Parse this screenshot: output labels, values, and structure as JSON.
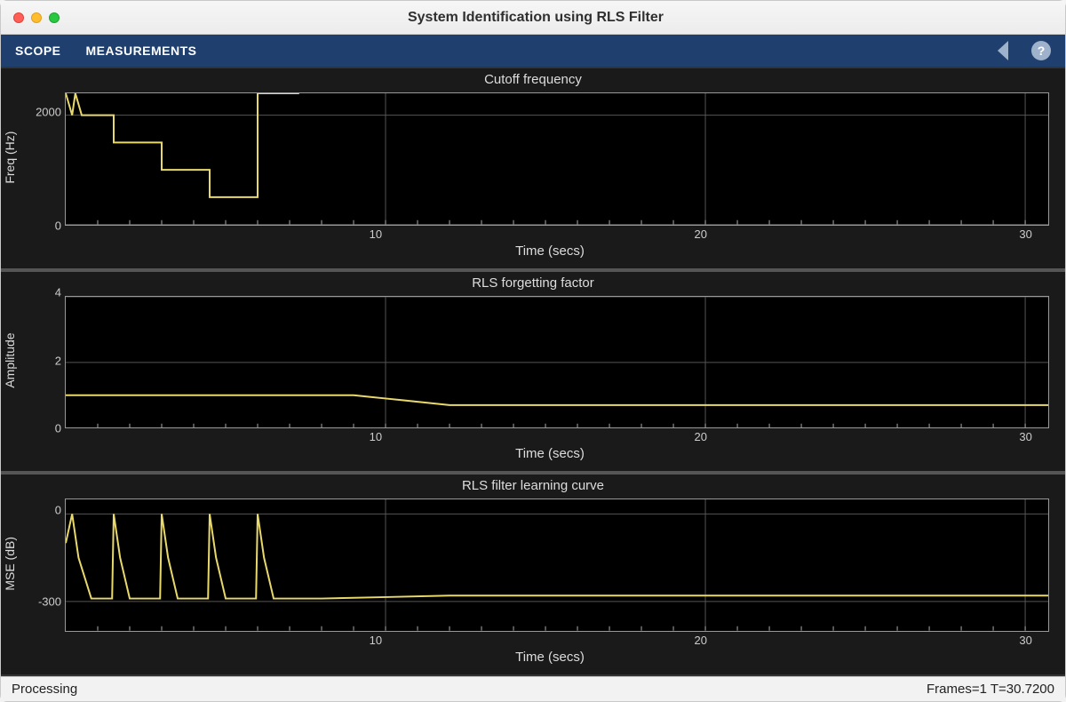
{
  "window": {
    "title": "System Identification using RLS Filter"
  },
  "toolbar": {
    "tabs": [
      "SCOPE",
      "MEASUREMENTS"
    ],
    "help_tooltip": "?"
  },
  "status": {
    "left": "Processing",
    "right": "Frames=1  T=30.7200"
  },
  "chart_data": [
    {
      "type": "line",
      "title": "Cutoff frequency",
      "xlabel": "Time (secs)",
      "ylabel": "Freq (Hz)",
      "xlim": [
        0,
        30.72
      ],
      "ylim": [
        0,
        2400
      ],
      "xticks": [
        10,
        20,
        30
      ],
      "yticks": [
        0,
        2000
      ],
      "x": [
        0,
        0.2,
        0.3,
        0.5,
        1.5,
        1.5,
        3.0,
        3.0,
        4.5,
        4.5,
        6.0,
        6.0,
        7.3,
        7.3
      ],
      "y": [
        2400,
        2000,
        2400,
        2000,
        2000,
        1500,
        1500,
        1000,
        1000,
        500,
        500,
        2400,
        2400,
        2400
      ]
    },
    {
      "type": "line",
      "title": "RLS forgetting factor",
      "xlabel": "Time (secs)",
      "ylabel": "Amplitude",
      "xlim": [
        0,
        30.72
      ],
      "ylim": [
        0,
        4
      ],
      "xticks": [
        10,
        20,
        30
      ],
      "yticks": [
        0,
        2,
        4
      ],
      "x": [
        0,
        9,
        9.5,
        10,
        10.5,
        11,
        11.5,
        12,
        30.72
      ],
      "y": [
        1,
        1,
        0.95,
        0.9,
        0.85,
        0.8,
        0.75,
        0.7,
        0.7
      ]
    },
    {
      "type": "line",
      "title": "RLS filter learning curve",
      "xlabel": "Time (secs)",
      "ylabel": "MSE (dB)",
      "xlim": [
        0,
        30.72
      ],
      "ylim": [
        -400,
        50
      ],
      "xticks": [
        10,
        20,
        30
      ],
      "yticks": [
        -300,
        0
      ],
      "x": [
        0,
        0.2,
        0.4,
        0.8,
        1.45,
        1.5,
        1.7,
        2.0,
        2.95,
        3.0,
        3.2,
        3.5,
        4.45,
        4.5,
        4.7,
        5.0,
        5.95,
        6.0,
        6.2,
        6.5,
        8,
        10,
        12,
        30.72
      ],
      "y": [
        -100,
        0,
        -150,
        -290,
        -290,
        0,
        -150,
        -290,
        -290,
        0,
        -150,
        -290,
        -290,
        0,
        -150,
        -290,
        -290,
        0,
        -150,
        -290,
        -290,
        -285,
        -280,
        -280
      ]
    }
  ]
}
